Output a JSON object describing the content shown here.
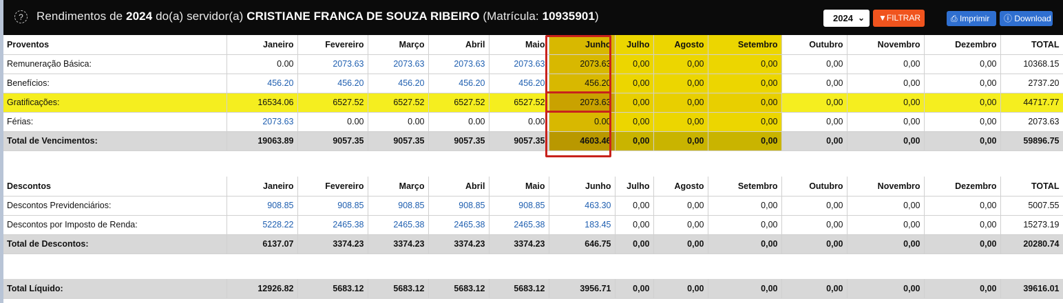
{
  "header": {
    "help_icon": "?",
    "title_prefix": "Rendimentos de ",
    "year": "2024",
    "title_mid": " do(a) servidor(a) ",
    "name": "CRISTIANE FRANCA DE SOUZA RIBEIRO",
    "matricula_label": " (Matrícula: ",
    "matricula": "10935901",
    "matricula_close": ")",
    "year_select": "2024",
    "filtrar_label": "FILTRAR",
    "imprimir_label": "Imprimir",
    "download_label": "Download"
  },
  "months": [
    "Janeiro",
    "Fevereiro",
    "Março",
    "Abril",
    "Maio",
    "Junho",
    "Julho",
    "Agosto",
    "Setembro",
    "Outubro",
    "Novembro",
    "Dezembro",
    "TOTAL"
  ],
  "proventos": {
    "header": "Proventos",
    "rows": [
      {
        "label": "Remuneração Básica:",
        "values": [
          "0.00",
          "2073.63",
          "2073.63",
          "2073.63",
          "2073.63",
          "2073.63",
          "0,00",
          "0,00",
          "0,00",
          "0,00",
          "0,00",
          "0,00",
          "10368.15"
        ]
      },
      {
        "label": "Benefícios:",
        "values": [
          "456.20",
          "456.20",
          "456.20",
          "456.20",
          "456.20",
          "456.20",
          "0,00",
          "0,00",
          "0,00",
          "0,00",
          "0,00",
          "0,00",
          "2737.20"
        ]
      },
      {
        "label": "Gratificações:",
        "values": [
          "16534.06",
          "6527.52",
          "6527.52",
          "6527.52",
          "6527.52",
          "2073.63",
          "0,00",
          "0,00",
          "0,00",
          "0,00",
          "0,00",
          "0,00",
          "44717.77"
        ]
      },
      {
        "label": "Férias:",
        "values": [
          "2073.63",
          "0.00",
          "0.00",
          "0.00",
          "0.00",
          "0.00",
          "0,00",
          "0,00",
          "0,00",
          "0,00",
          "0,00",
          "0,00",
          "2073.63"
        ]
      }
    ],
    "total": {
      "label": "Total de Vencimentos:",
      "values": [
        "19063.89",
        "9057.35",
        "9057.35",
        "9057.35",
        "9057.35",
        "4603.46",
        "0,00",
        "0,00",
        "0,00",
        "0,00",
        "0,00",
        "0,00",
        "59896.75"
      ]
    }
  },
  "descontos": {
    "header": "Descontos",
    "rows": [
      {
        "label": "Descontos Previdenciários:",
        "values": [
          "908.85",
          "908.85",
          "908.85",
          "908.85",
          "908.85",
          "463.30",
          "0,00",
          "0,00",
          "0,00",
          "0,00",
          "0,00",
          "0,00",
          "5007.55"
        ]
      },
      {
        "label": "Descontos por Imposto de Renda:",
        "values": [
          "5228.22",
          "2465.38",
          "2465.38",
          "2465.38",
          "2465.38",
          "183.45",
          "0,00",
          "0,00",
          "0,00",
          "0,00",
          "0,00",
          "0,00",
          "15273.19"
        ]
      }
    ],
    "total": {
      "label": "Total de Descontos:",
      "values": [
        "6137.07",
        "3374.23",
        "3374.23",
        "3374.23",
        "3374.23",
        "646.75",
        "0,00",
        "0,00",
        "0,00",
        "0,00",
        "0,00",
        "0,00",
        "20280.74"
      ]
    }
  },
  "liquido": {
    "label": "Total Líquido:",
    "values": [
      "12926.82",
      "5683.12",
      "5683.12",
      "5683.12",
      "5683.12",
      "3956.71",
      "0,00",
      "0,00",
      "0,00",
      "0,00",
      "0,00",
      "0,00",
      "39616.01"
    ]
  }
}
